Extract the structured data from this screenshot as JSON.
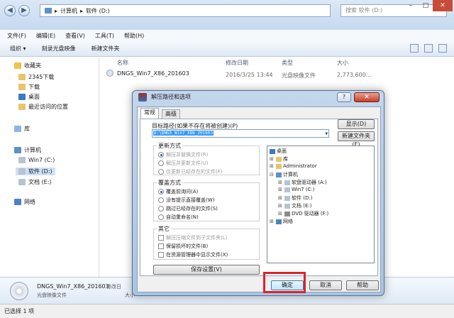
{
  "explorer": {
    "breadcrumb": [
      "计算机",
      "软件 (D:)"
    ],
    "search_placeholder": "搜索 软件 (D:)",
    "menu": [
      "文件(F)",
      "编辑(E)",
      "查看(V)",
      "工具(T)",
      "帮助(H)"
    ],
    "toolbar": [
      "组织 ▾",
      "刻录光盘映像",
      "新建文件夹"
    ],
    "sidebar": {
      "favorites": "收藏夹",
      "fav_items": [
        "2345下载",
        "下载",
        "桌面",
        "最近访问的位置"
      ],
      "libraries": "库",
      "computer": "计算机",
      "drives": [
        "Win7 (C:)",
        "软件 (D:)",
        "文档 (E:)"
      ],
      "network": "网络"
    },
    "columns": {
      "name": "名称",
      "modified": "修改日期",
      "type": "类型",
      "size": "大小"
    },
    "file": {
      "name": "DNGS_Win7_X86_201603",
      "modified": "2016/3/25 13:44",
      "type": "光盘映像文件",
      "size": "2,773,600..."
    },
    "details": {
      "name": "DNGS_Win7_X86_201603",
      "modified_label": "修改日",
      "type": "光盘映像文件",
      "size_label": "大小"
    },
    "status": "已选择 1 项"
  },
  "dialog": {
    "title": "解压路径和选项",
    "help": "?",
    "close": "✕",
    "tabs": [
      "常规",
      "高级"
    ],
    "path_label": "目标路径(如果不存在将被创建)(P)",
    "path_value": "D:\\DNGS_Win7_X86_201603",
    "show_button": "显示(D)",
    "new_folder_button": "新建文件夹(E)",
    "update_group": "更新方式",
    "update_options": [
      "解压并替换文件(R)",
      "解压并更新文件(U)",
      "仅更新已经存在的文件(F)"
    ],
    "overwrite_group": "覆盖方式",
    "overwrite_options": [
      "覆盖前询问(A)",
      "没有提示直接覆盖(W)",
      "跳过已经存在的文件(S)",
      "自动重命名(N)"
    ],
    "other_group": "其它",
    "other_options": [
      "解压压缩文件到子文件夹(L)",
      "保留损坏的文件(B)",
      "在资源管理器中显示文件(X)"
    ],
    "save_button": "保存设置(V)",
    "tree": {
      "desktop": "桌面",
      "library": "库",
      "admin": "Administrator",
      "computer": "计算机",
      "drives": [
        "软盘驱动器 (A:)",
        "Win7 (C:)",
        "软件 (D:)",
        "文档 (E:)",
        "DVD 驱动器 (F:)"
      ],
      "network": "网络"
    },
    "ok_button": "确定",
    "cancel_button": "取消",
    "help_button": "帮助"
  }
}
